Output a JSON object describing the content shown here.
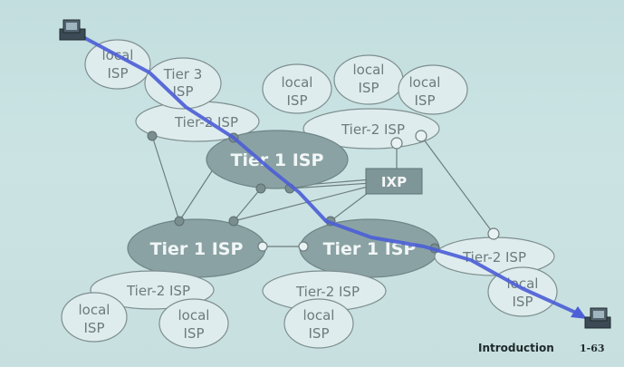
{
  "diagram": {
    "local_isp": [
      "local",
      "ISP"
    ],
    "tier3_isp": [
      "Tier 3",
      "ISP"
    ],
    "tier2_isp": "Tier-2 ISP",
    "tier1_isp": "Tier 1 ISP",
    "ixp": "IXP"
  },
  "footer": {
    "section": "Introduction",
    "page": "1-63"
  },
  "colors": {
    "route": "#4d5fd6",
    "tier1_fill": "#8aa2a4",
    "ixp_fill": "#7f9699"
  },
  "icons": {
    "source_host": "computer-icon",
    "destination_host": "computer-icon"
  }
}
